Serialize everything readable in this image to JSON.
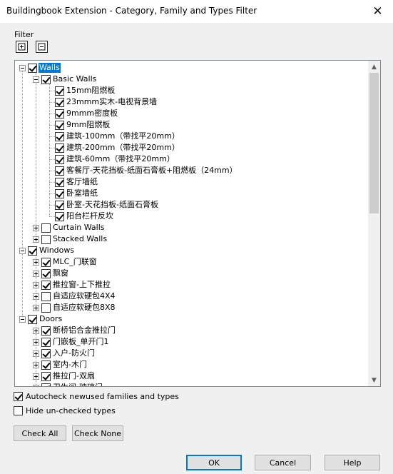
{
  "window": {
    "title": "Buildingbook Extension - Category, Family and Types Filter",
    "close_glyph": "✕"
  },
  "filter": {
    "label": "Filter",
    "expand_all_icon": "plus-box-icon",
    "collapse_all_icon": "minus-box-icon"
  },
  "tree": [
    {
      "label": "Walls",
      "level": 0,
      "expander": "minus",
      "checked": true,
      "selected": true
    },
    {
      "label": "Basic Walls",
      "level": 1,
      "expander": "minus",
      "checked": true
    },
    {
      "label": "15mm阻燃板",
      "level": 2,
      "expander": "none",
      "checked": true
    },
    {
      "label": "23mmm实木-电视背景墙",
      "level": 2,
      "expander": "none",
      "checked": true
    },
    {
      "label": "9mmm密度板",
      "level": 2,
      "expander": "none",
      "checked": true
    },
    {
      "label": "9mm阻燃板",
      "level": 2,
      "expander": "none",
      "checked": true
    },
    {
      "label": "建筑-100mm（带找平20mm）",
      "level": 2,
      "expander": "none",
      "checked": true
    },
    {
      "label": "建筑-200mm（带找平20mm）",
      "level": 2,
      "expander": "none",
      "checked": true
    },
    {
      "label": "建筑-60mm（带找平20mm）",
      "level": 2,
      "expander": "none",
      "checked": true
    },
    {
      "label": "客餐厅-天花挡板-纸面石膏板+阻燃板（24mm）",
      "level": 2,
      "expander": "none",
      "checked": true
    },
    {
      "label": "客厅墙纸",
      "level": 2,
      "expander": "none",
      "checked": true
    },
    {
      "label": "卧室墙纸",
      "level": 2,
      "expander": "none",
      "checked": true
    },
    {
      "label": "卧室-天花挡板-纸面石膏板",
      "level": 2,
      "expander": "none",
      "checked": true
    },
    {
      "label": "阳台栏杆反坎",
      "level": 2,
      "expander": "none",
      "checked": true
    },
    {
      "label": "Curtain Walls",
      "level": 1,
      "expander": "plus",
      "checked": false
    },
    {
      "label": "Stacked Walls",
      "level": 1,
      "expander": "plus",
      "checked": false
    },
    {
      "label": "Windows",
      "level": 0,
      "expander": "minus",
      "checked": true
    },
    {
      "label": "MLC_门联窗",
      "level": 1,
      "expander": "plus",
      "checked": true
    },
    {
      "label": "飘窗",
      "level": 1,
      "expander": "plus",
      "checked": true
    },
    {
      "label": "推拉窗-上下推拉",
      "level": 1,
      "expander": "plus",
      "checked": true
    },
    {
      "label": "自适应软硬包4X4",
      "level": 1,
      "expander": "plus",
      "checked": false
    },
    {
      "label": "自适应软硬包8X8",
      "level": 1,
      "expander": "plus",
      "checked": false
    },
    {
      "label": "Doors",
      "level": 0,
      "expander": "minus",
      "checked": true
    },
    {
      "label": "断桥铝合金推拉门",
      "level": 1,
      "expander": "plus",
      "checked": true
    },
    {
      "label": "门嵌板_单开门1",
      "level": 1,
      "expander": "plus",
      "checked": true
    },
    {
      "label": "入户-防火门",
      "level": 1,
      "expander": "plus",
      "checked": true
    },
    {
      "label": "室内-木门",
      "level": 1,
      "expander": "plus",
      "checked": true
    },
    {
      "label": "推拉门-双扇",
      "level": 1,
      "expander": "plus",
      "checked": true
    },
    {
      "label": "卫生间-玻璃门",
      "level": 1,
      "expander": "plus",
      "checked": true
    }
  ],
  "scrollbar": {
    "up_icon": "scroll-up-arrow-icon",
    "down_icon": "scroll-down-arrow-icon"
  },
  "options": {
    "autocheck": {
      "label": "Autocheck newused families and types",
      "checked": true
    },
    "hide_unchecked": {
      "label": "Hide un-checked types",
      "checked": false
    }
  },
  "buttons": {
    "check_all": "Check All",
    "check_none": "Check None",
    "ok": "OK",
    "cancel": "Cancel",
    "help": "Help"
  },
  "colors": {
    "selection": "#0078d7",
    "default_button_border": "#0078d7"
  }
}
